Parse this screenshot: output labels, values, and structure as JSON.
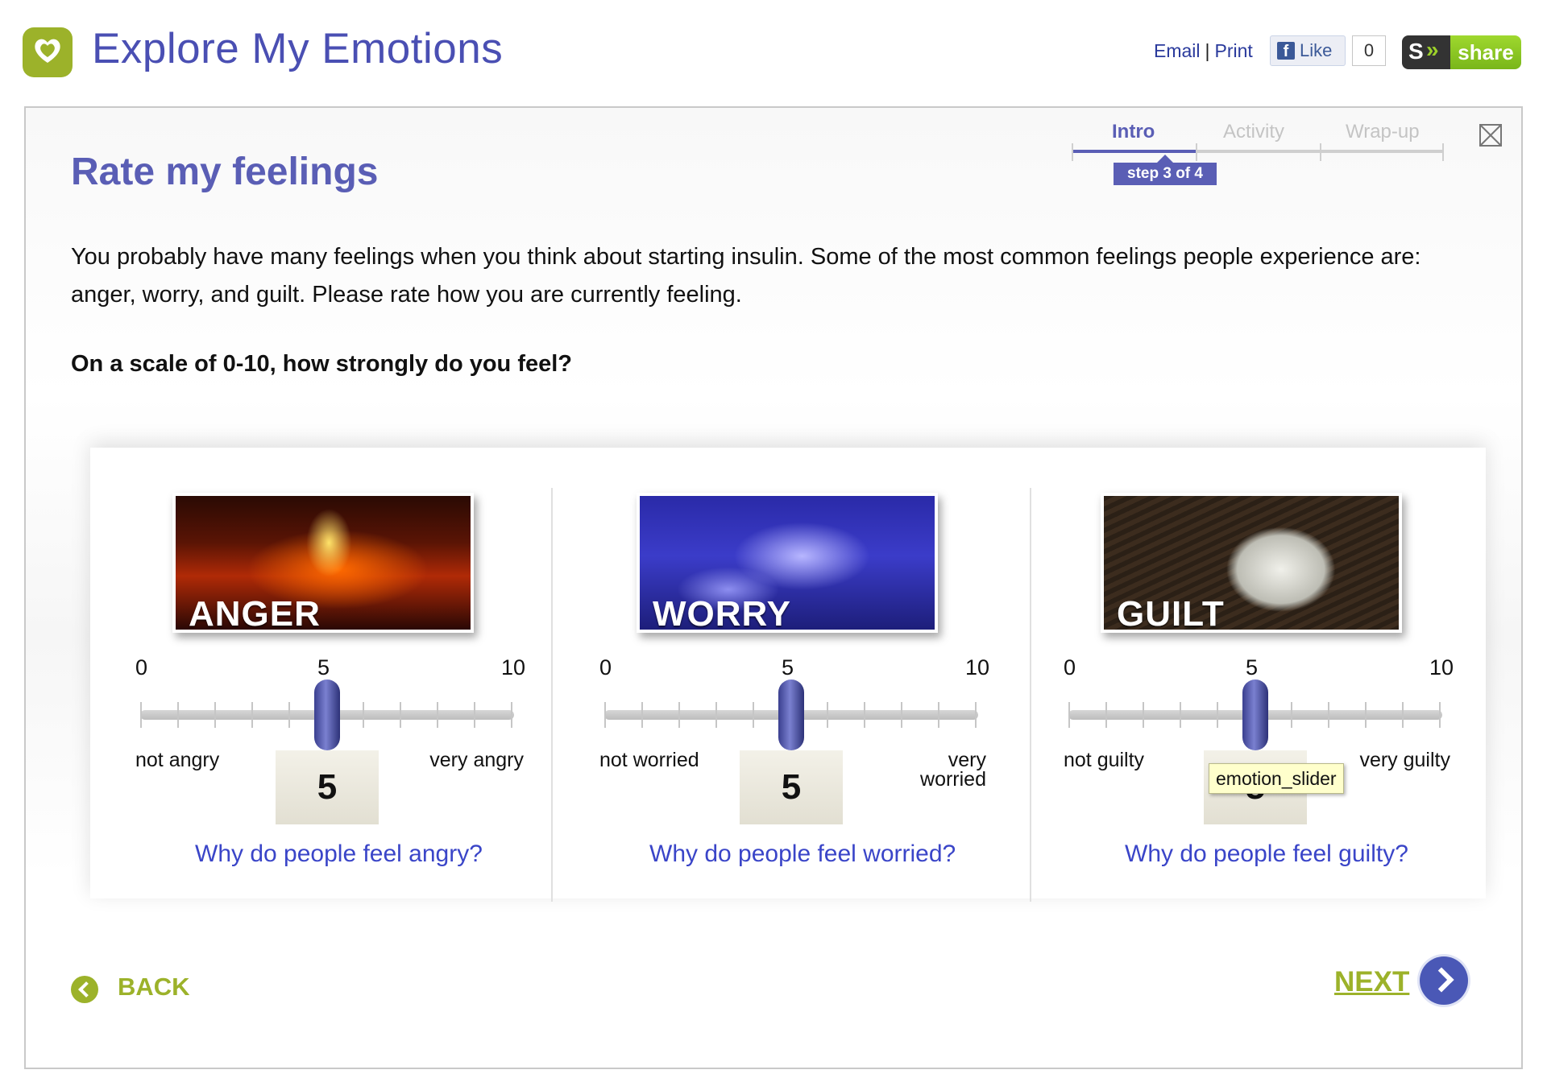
{
  "header": {
    "app_title": "Explore My Emotions",
    "email_link": "Email",
    "separator": "|",
    "print_link": "Print",
    "fb_like_label": "Like",
    "fb_like_count": "0",
    "share_label": "share",
    "share_badge": "S"
  },
  "page": {
    "title": "Rate my feelings",
    "intro_text": "You probably have many feelings when you think about starting insulin. Some of the most common feelings people experience are: anger, worry, and guilt. Please rate how you are currently feeling.",
    "question": "On a scale of 0-10, how strongly do you feel?"
  },
  "steps": {
    "items": [
      {
        "label": "Intro",
        "active": true
      },
      {
        "label": "Activity",
        "active": false
      },
      {
        "label": "Wrap-up",
        "active": false
      }
    ],
    "badge": "step 3 of 4"
  },
  "emotions": [
    {
      "name": "ANGER",
      "min": "0",
      "mid": "5",
      "max": "10",
      "low_label": "not angry",
      "high_label": "very angry",
      "value": "5",
      "link": "Why do people feel angry?"
    },
    {
      "name": "WORRY",
      "min": "0",
      "mid": "5",
      "max": "10",
      "low_label": "not worried",
      "high_label": "very worried",
      "value": "5",
      "link": "Why do people feel worried?"
    },
    {
      "name": "GUILT",
      "min": "0",
      "mid": "5",
      "max": "10",
      "low_label": "not guilty",
      "high_label": "very guilty",
      "value": "5",
      "link": "Why do people feel guilty?"
    }
  ],
  "tooltip": "emotion_slider",
  "nav": {
    "back_label": "BACK",
    "next_label": "NEXT"
  },
  "colors": {
    "brand_green": "#9cb22a",
    "brand_purple": "#5a5eb5",
    "link_blue": "#3a45c8"
  }
}
